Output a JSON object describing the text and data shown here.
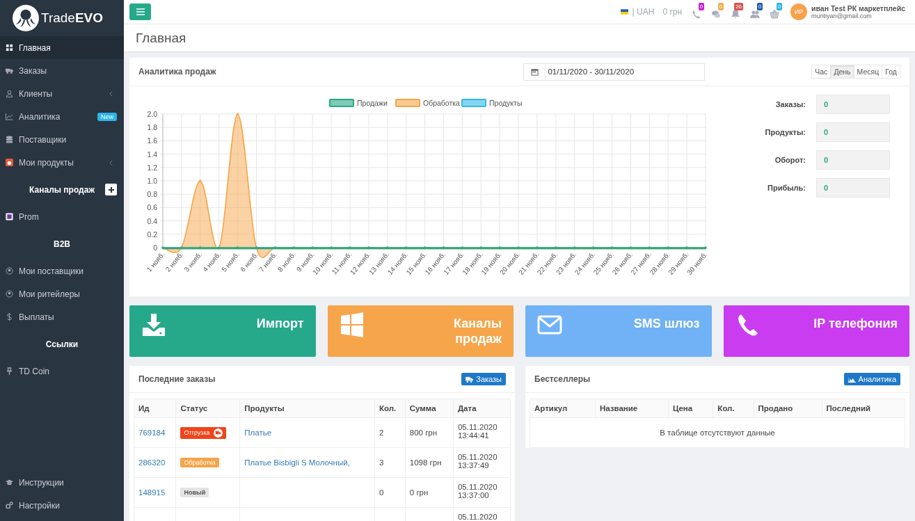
{
  "logo": {
    "text": "Trade**EVO**"
  },
  "sidebar": {
    "items": [
      {
        "kind": "link",
        "label": "Главная",
        "selected": true
      },
      {
        "kind": "link",
        "label": "Заказы",
        "selected": false
      },
      {
        "kind": "link",
        "label": "Клиенты",
        "selected": false,
        "submenu": true
      },
      {
        "kind": "link",
        "label": "Аналитика",
        "selected": false,
        "badge": "New"
      },
      {
        "kind": "link",
        "label": "Поставщики",
        "selected": false
      },
      {
        "kind": "link",
        "label": "Мои продукты",
        "selected": false,
        "submenu": true
      },
      {
        "kind": "header",
        "label": "Каналы продаж",
        "add_button": true
      },
      {
        "kind": "link",
        "label": "Prom",
        "selected": false
      },
      {
        "kind": "header",
        "label": "B2B"
      },
      {
        "kind": "link",
        "label": "Мои поставщики",
        "selected": false
      },
      {
        "kind": "link",
        "label": "Мои ритейлеры",
        "selected": false
      },
      {
        "kind": "link",
        "label": "Выплаты",
        "selected": false
      },
      {
        "kind": "header",
        "label": "Ссылки"
      },
      {
        "kind": "link",
        "label": "TD Coin",
        "selected": false
      }
    ],
    "bottom_items": [
      {
        "label": "Инструкции",
        "selected": false
      },
      {
        "label": "Настройки",
        "selected": false
      }
    ]
  },
  "topbar": {
    "currency": "| UAH",
    "balance": "0 грн",
    "notifications": [
      {
        "count": "0",
        "color": "#c026d3"
      },
      {
        "count": "0",
        "color": "#f0ad4e"
      },
      {
        "count": "26",
        "color": "#d9534f"
      },
      {
        "count": "0",
        "color": "#1f5fa6"
      },
      {
        "count": "0",
        "color": "#2bb5e8"
      }
    ],
    "user": {
      "initials": "ИР",
      "name": "иван Test РК маркетплейс",
      "email": "muntiyan@gmail.com"
    }
  },
  "page_title": "Главная",
  "analytics": {
    "title": "Аналитика продаж",
    "date_range": "01/11/2020 - 30/11/2020",
    "periods": [
      {
        "label": "Час",
        "selected": false
      },
      {
        "label": "День",
        "selected": true
      },
      {
        "label": "Месяц",
        "selected": false
      },
      {
        "label": "Год",
        "selected": false
      }
    ],
    "chart_data": {
      "type": "area",
      "categories": [
        "1 нояб.",
        "2 нояб.",
        "3 нояб.",
        "4 нояб.",
        "5 нояб.",
        "6 нояб.",
        "7 нояб.",
        "8 нояб.",
        "9 нояб.",
        "10 нояб.",
        "11 нояб.",
        "12 нояб.",
        "13 нояб.",
        "14 нояб.",
        "15 нояб.",
        "16 нояб.",
        "17 нояб.",
        "18 нояб.",
        "19 нояб.",
        "20 нояб.",
        "21 нояб.",
        "22 нояб.",
        "23 нояб.",
        "24 нояб.",
        "25 нояб.",
        "26 нояб.",
        "27 нояб.",
        "28 нояб.",
        "29 нояб.",
        "30 нояб."
      ],
      "series": [
        {
          "name": "Продажи",
          "color": "#2aa884",
          "values": [
            0,
            0,
            0,
            0,
            0,
            0,
            0,
            0,
            0,
            0,
            0,
            0,
            0,
            0,
            0,
            0,
            0,
            0,
            0,
            0,
            0,
            0,
            0,
            0,
            0,
            0,
            0,
            0,
            0,
            0
          ]
        },
        {
          "name": "Обработка",
          "color": "#f5a54a",
          "values": [
            0,
            0,
            1,
            0,
            2,
            0,
            0,
            0,
            0,
            0,
            0,
            0,
            0,
            0,
            0,
            0,
            0,
            0,
            0,
            0,
            0,
            0,
            0,
            0,
            0,
            0,
            0,
            0,
            0,
            0
          ]
        },
        {
          "name": "Продукты",
          "color": "#36b9e6",
          "values": [
            null,
            null,
            null,
            null,
            null,
            null,
            null,
            null,
            null,
            null,
            null,
            null,
            null,
            null,
            null,
            null,
            null,
            null,
            null,
            null,
            null,
            null,
            null,
            null,
            null,
            null,
            null,
            null,
            null,
            null
          ]
        }
      ],
      "legend": "top",
      "grid": true,
      "ylim": [
        0,
        2
      ],
      "yticks": [
        {
          "value": 0,
          "label": "0"
        },
        {
          "value": 0.2,
          "label": "0.2"
        },
        {
          "value": 0.4,
          "label": "0.4"
        },
        {
          "value": 0.6,
          "label": "0.6"
        },
        {
          "value": 0.8,
          "label": "0.8"
        },
        {
          "value": 1,
          "label": "1.0"
        },
        {
          "value": 1.2,
          "label": "1.2"
        },
        {
          "value": 1.4,
          "label": "1.4"
        },
        {
          "value": 1.6,
          "label": "1.6"
        },
        {
          "value": 1.8,
          "label": "1.8"
        },
        {
          "value": 2,
          "label": "2.0"
        }
      ]
    },
    "stats": [
      {
        "label": "Заказы:",
        "value": "0"
      },
      {
        "label": "Продукты:",
        "value": "0"
      },
      {
        "label": "Оборот:",
        "value": "0"
      },
      {
        "label": "Прибыль:",
        "value": "0"
      }
    ]
  },
  "tiles": [
    {
      "label": "Импорт",
      "color": "#26a98b"
    },
    {
      "label": "Каналы продаж",
      "color": "#f6a54a"
    },
    {
      "label": "SMS шлюз",
      "color": "#70b2f5"
    },
    {
      "label": "IP телефония",
      "color": "#c93cf0"
    }
  ],
  "orders": {
    "title": "Последние заказы",
    "button": "Заказы",
    "columns": [
      "Ид",
      "Статус",
      "Продукты",
      "Кол.",
      "Сумма",
      "Дата"
    ],
    "rows": [
      {
        "id": "769184",
        "status": {
          "label": "Отгрузка",
          "color": "#f0441a",
          "shipping_icon": true
        },
        "product": "Платье",
        "qty": "2",
        "sum": "800 грн",
        "date": "05.11.2020",
        "time": "13:44:41"
      },
      {
        "id": "286320",
        "status": {
          "label": "Обработка",
          "color": "#f5a54a"
        },
        "product": "Платье Bisbigli S Молочный,",
        "qty": "3",
        "sum": "1098 грн",
        "date": "05.11.2020",
        "time": "13:37:49"
      },
      {
        "id": "148915",
        "status": {
          "label": "Новый",
          "color": "#e4e4e4"
        },
        "qty": "0",
        "sum": "0 грн",
        "date": "05.11.2020",
        "time": "13:37:00"
      },
      {
        "date": "05.11.2020"
      }
    ]
  },
  "bestsellers": {
    "title": "Бестселлеры",
    "button": "Аналитика",
    "columns": [
      "Артикул",
      "Название",
      "Цена",
      "Кол.",
      "Продано",
      "Последний"
    ],
    "empty": "В таблице отсутствуют данные"
  }
}
